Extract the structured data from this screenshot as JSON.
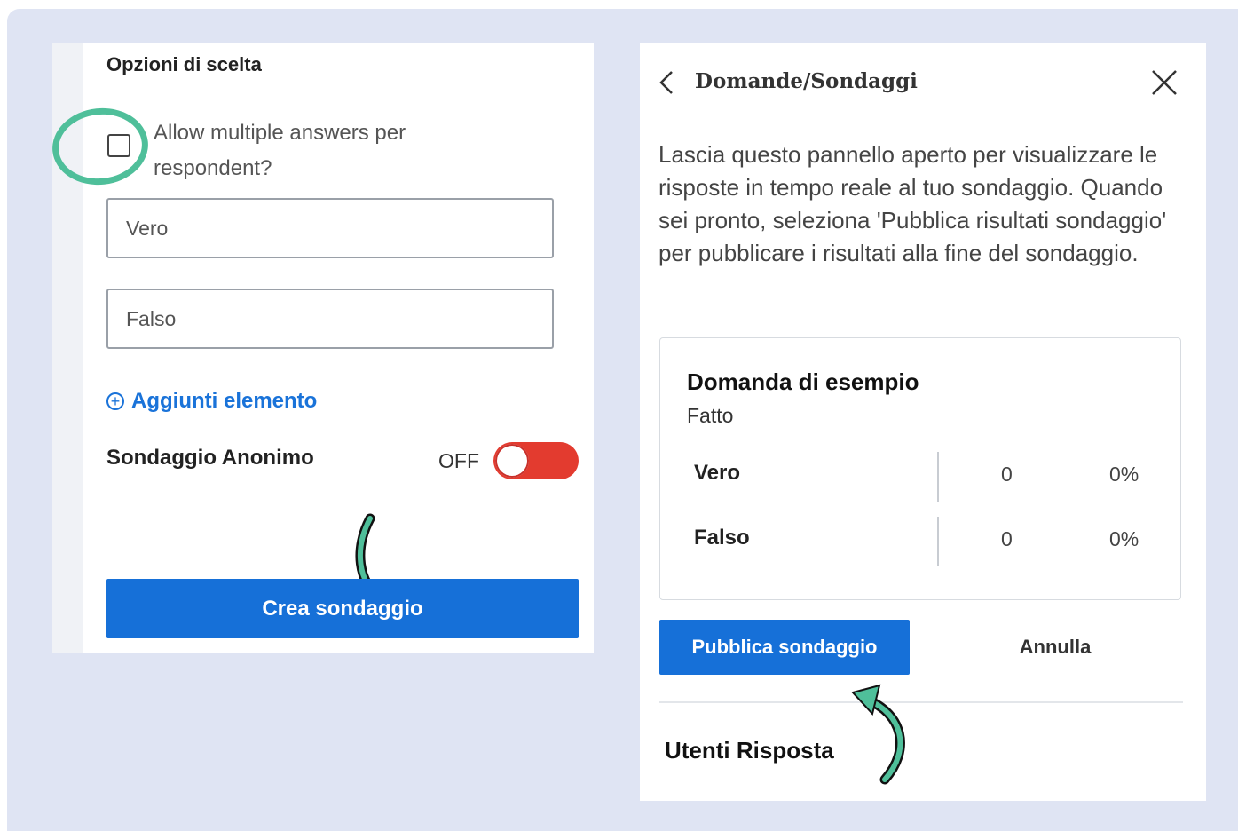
{
  "left": {
    "title": "Opzioni di scelta",
    "allow_multiple_label": "Allow multiple answers per respondent?",
    "options": [
      {
        "value": "Vero"
      },
      {
        "value": "Falso"
      }
    ],
    "add_item_label": "Aggiunti elemento",
    "anonymous_label": "Sondaggio Anonimo",
    "toggle_state": "OFF",
    "create_button": "Crea sondaggio"
  },
  "right": {
    "title": "Domande/Sondaggi",
    "description": "Lascia questo pannello aperto per visualizzare le risposte in tempo reale al tuo sondaggio. Quando sei pronto, seleziona 'Pubblica risultati sondaggio' per pubblicare i risultati alla fine del sondaggio.",
    "question": {
      "title": "Domanda di esempio",
      "status": "Fatto",
      "results": [
        {
          "label": "Vero",
          "count": "0",
          "percent": "0%"
        },
        {
          "label": "Falso",
          "count": "0",
          "percent": "0%"
        }
      ]
    },
    "publish_button": "Pubblica sondaggio",
    "cancel_button": "Annulla",
    "users_section_title": "Utenti Risposta"
  },
  "colors": {
    "background": "#dfe4f3",
    "primary": "#1670d8",
    "toggle_off": "#e33b2f",
    "highlight": "#4fbf9a"
  },
  "icons": [
    "back-chevron-icon",
    "close-icon",
    "plus-circle-icon",
    "checkbox-icon",
    "annotation-arrow-icon"
  ]
}
